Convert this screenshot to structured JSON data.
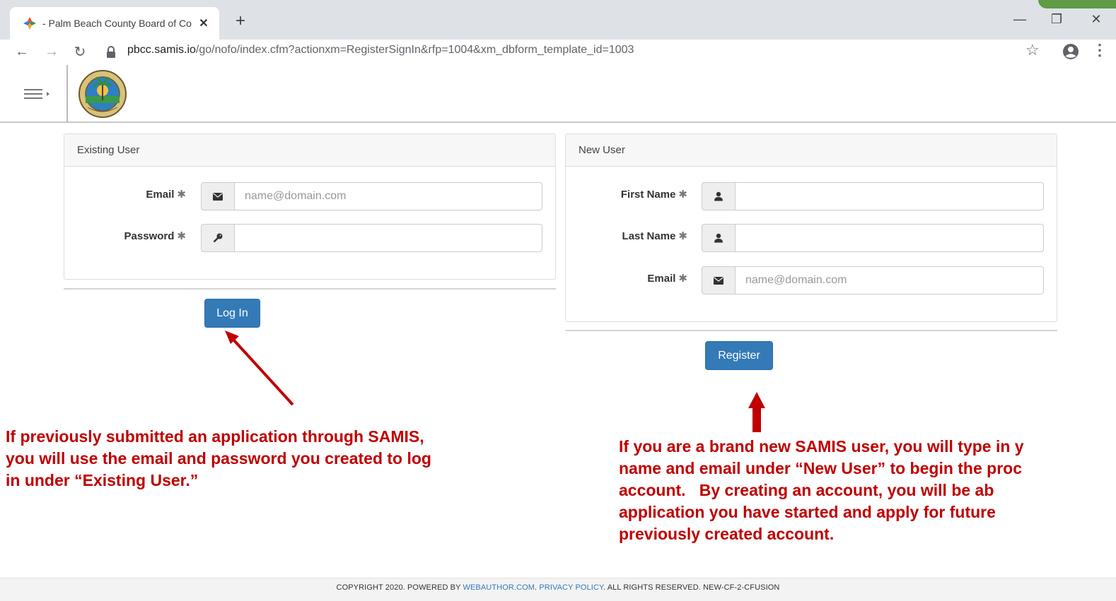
{
  "browser": {
    "tab_title": "- Palm Beach County Board of Co",
    "tab_close": "✕",
    "new_tab": "+",
    "url_host": "pbcc.samis.io",
    "url_path": "/go/nofo/index.cfm?actionxm=RegisterSignIn&rfp=1004&xm_dbform_template_id=1003",
    "back": "←",
    "forward": "→",
    "reload": "↻",
    "star": "☆",
    "menu": "⋮",
    "minimize": "—",
    "restore": "❐",
    "close": "✕"
  },
  "existing_user": {
    "title": "Existing User",
    "email_label": "Email",
    "email_placeholder": "name@domain.com",
    "password_label": "Password",
    "required_mark": "✱",
    "login_button": "Log In"
  },
  "new_user": {
    "title": "New User",
    "first_name_label": "First Name",
    "last_name_label": "Last Name",
    "email_label": "Email",
    "email_placeholder": "name@domain.com",
    "required_mark": "✱",
    "register_button": "Register"
  },
  "annotations": {
    "left": "If previously submitted an application through SAMIS,\nyou will use the email and password you created to log\nin under “Existing User.”",
    "right": "If you are a brand new SAMIS user, you will type in y\nname and email under “New User” to begin the proc\naccount.   By creating an account, you will be ab\napplication you have started and apply for future\npreviously created account."
  },
  "footer": {
    "text1": "COPYRIGHT 2020. POWERED BY ",
    "link1": "WEBAUTHOR.COM",
    "text2": ". ",
    "link2": "PRIVACY POLICY",
    "text3": ". ALL RIGHTS RESERVED. NEW-CF-2-CFUSION"
  },
  "colors": {
    "primary_button": "#337ab7",
    "annotation_red": "#c00000"
  }
}
